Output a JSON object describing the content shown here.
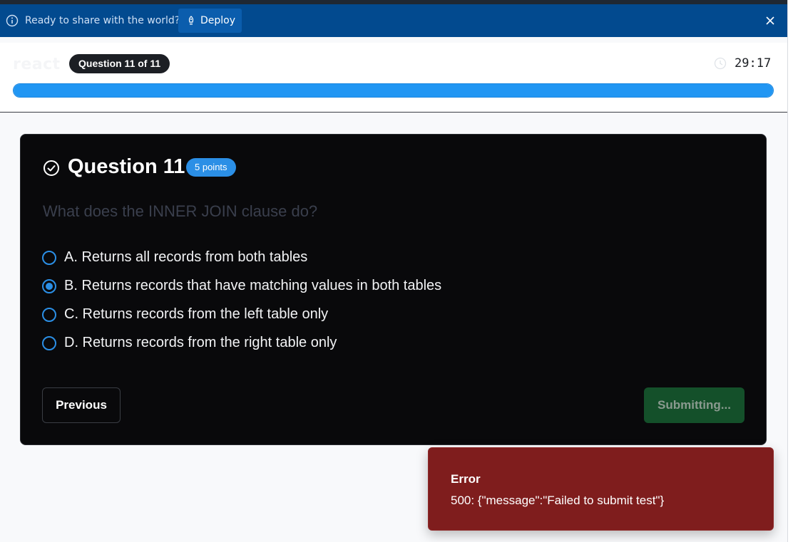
{
  "banner": {
    "text": "Ready to share with the world?",
    "deploy_label": "Deploy",
    "info_icon": "info-icon",
    "deploy_icon": "rocket-icon",
    "close_icon": "close-icon",
    "color": "#024a8f"
  },
  "header": {
    "brand": "react",
    "question_pill": "Question 11 of 11",
    "timer": "29:17",
    "progress_fraction": 1.0,
    "progress_color": "#2196f3"
  },
  "question": {
    "title": "Question 11",
    "points": "5 points",
    "text": "What does the INNER JOIN clause do?",
    "options": [
      {
        "label": "A. Returns all records from both tables",
        "selected": false
      },
      {
        "label": "B. Returns records that have matching values in both tables",
        "selected": true
      },
      {
        "label": "C. Returns records from the left table only",
        "selected": false
      },
      {
        "label": "D. Returns records from the right table only",
        "selected": false
      }
    ],
    "previous_label": "Previous",
    "submit_label": "Submitting..."
  },
  "toast": {
    "title": "Error",
    "message": "500: {\"message\":\"Failed to submit test\"}",
    "color": "#7f1d1d"
  }
}
